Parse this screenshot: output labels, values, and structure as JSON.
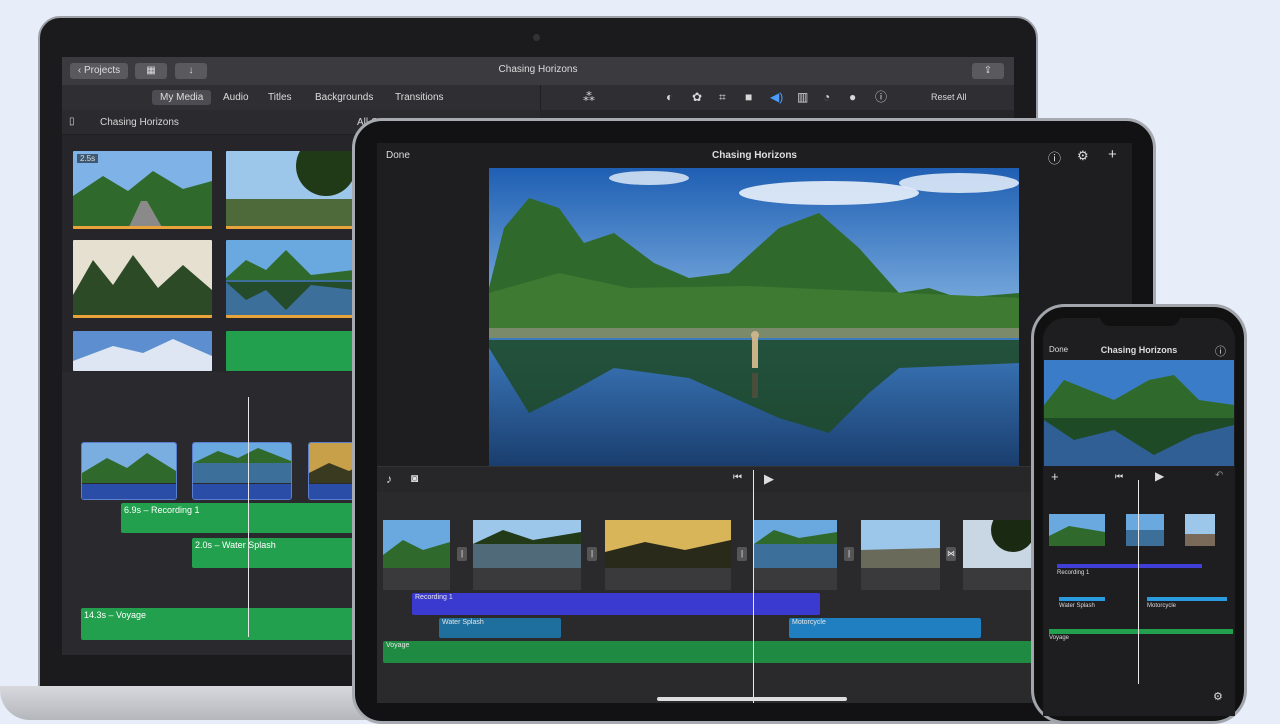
{
  "mac": {
    "toolbar": {
      "projects_label": "Projects",
      "title": "Chasing Horizons"
    },
    "tabs": [
      {
        "label": "My Media"
      },
      {
        "label": "Audio"
      },
      {
        "label": "Titles"
      },
      {
        "label": "Backgrounds"
      },
      {
        "label": "Transitions"
      }
    ],
    "reset_label": "Reset All",
    "library": {
      "title": "Chasing Horizons",
      "filter": "All C"
    },
    "thumb_badge": "2.5s",
    "audio": {
      "recording": "6.9s – Recording 1",
      "splash": "2.0s – Water Splash",
      "voyage": "14.3s – Voyage"
    }
  },
  "ipad": {
    "done_label": "Done",
    "title": "Chasing Horizons",
    "tracks": {
      "recording": "Recording 1",
      "splash": "Water Splash",
      "motorcycle": "Motorcycle",
      "voyage": "Voyage"
    }
  },
  "iphone": {
    "done_label": "Done",
    "title": "Chasing Horizons",
    "tracks": {
      "recording": "Recording 1",
      "splash": "Water Splash",
      "motorcycle": "Motorcycle",
      "voyage": "Voyage"
    }
  },
  "icons": [
    "chevron-left-icon",
    "media-browser-icon",
    "import-icon",
    "share-icon",
    "magic-wand-icon",
    "color-balance-icon",
    "color-palette-icon",
    "crop-icon",
    "camera-icon",
    "volume-icon",
    "equalizer-icon",
    "speed-icon",
    "filter-icon",
    "info-icon",
    "sidebar-icon",
    "help-icon",
    "settings-icon",
    "add-icon",
    "microphone-icon",
    "photo-camera-icon",
    "skip-back-icon",
    "play-icon",
    "undo-icon"
  ],
  "colors": {
    "audio_green": "#22a04e",
    "recording_blue": "#3a3ad0",
    "splash_blue": "#2b9be0",
    "clip_blue": "#2a4ea8"
  }
}
